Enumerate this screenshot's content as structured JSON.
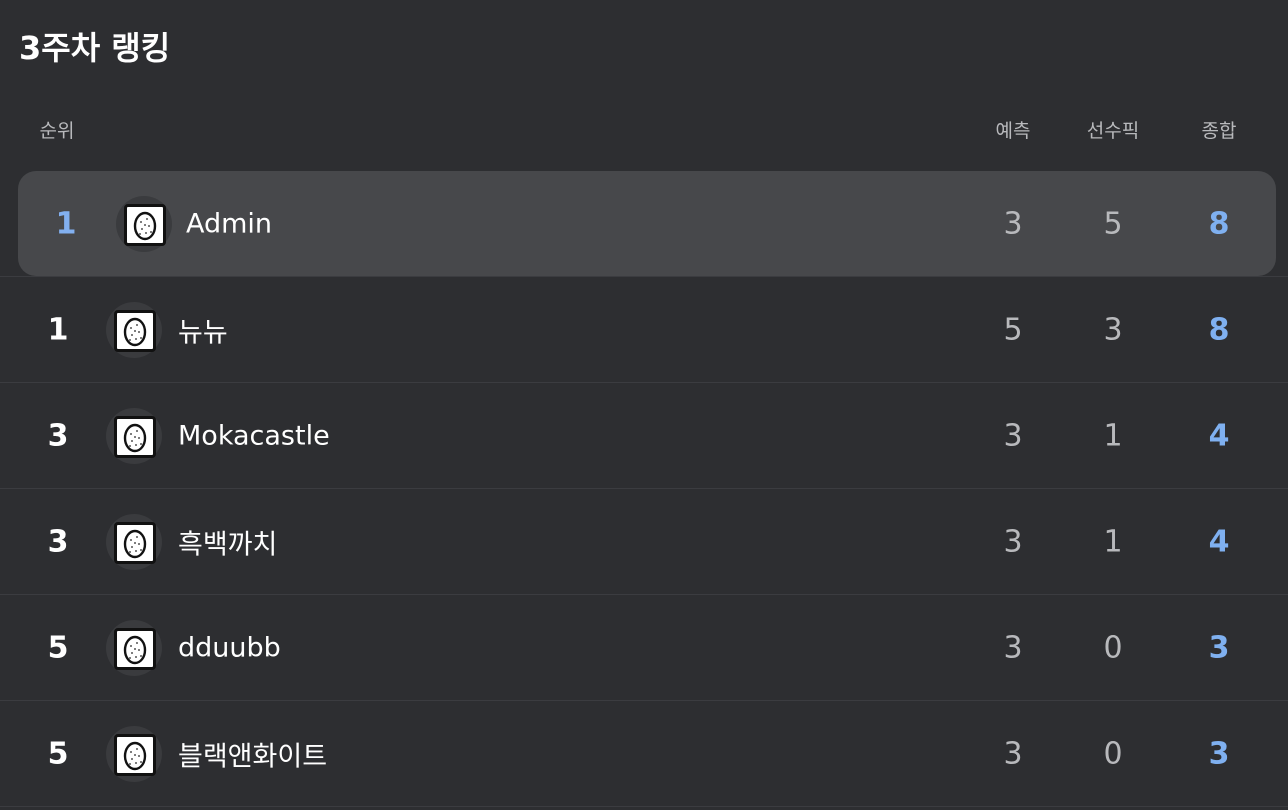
{
  "page": {
    "title": "3주차 랭킹"
  },
  "table": {
    "headers": {
      "rank": "순위",
      "prediction": "예측",
      "player_pick": "선수픽",
      "total": "종합"
    },
    "rows": [
      {
        "rank": "1",
        "name": "Admin",
        "prediction": "3",
        "player_pick": "5",
        "total": "8",
        "avatar_icon": "egg-icon"
      },
      {
        "rank": "1",
        "name": "뉴뉴",
        "prediction": "5",
        "player_pick": "3",
        "total": "8",
        "avatar_icon": "egg-icon"
      },
      {
        "rank": "3",
        "name": "Mokacastle",
        "prediction": "3",
        "player_pick": "1",
        "total": "4",
        "avatar_icon": "egg-icon"
      },
      {
        "rank": "3",
        "name": "흑백까치",
        "prediction": "3",
        "player_pick": "1",
        "total": "4",
        "avatar_icon": "egg-icon"
      },
      {
        "rank": "5",
        "name": "dduubb",
        "prediction": "3",
        "player_pick": "0",
        "total": "3",
        "avatar_icon": "egg-icon"
      },
      {
        "rank": "5",
        "name": "블랙앤화이트",
        "prediction": "3",
        "player_pick": "0",
        "total": "3",
        "avatar_icon": "egg-icon"
      }
    ]
  },
  "colors": {
    "background": "#2d2e31",
    "highlight_row": "#47484b",
    "accent_blue": "#7fb0f0",
    "muted_text": "#b8b9bc"
  }
}
